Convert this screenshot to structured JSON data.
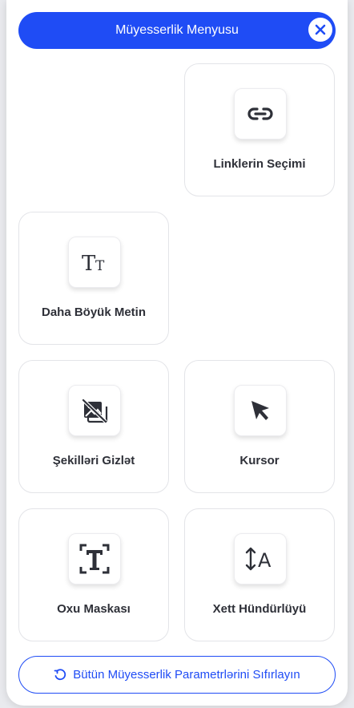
{
  "header": {
    "title": "Müyesserlik Menyusu",
    "close_icon": "close-icon"
  },
  "tiles": {
    "links": {
      "label": "Linklerin Seçimi",
      "icon": "link-icon"
    },
    "bigger_text": {
      "label": "Daha Böyük Metin",
      "icon": "text-size-icon"
    },
    "hide_images": {
      "label": "Şekilləri Gizlət",
      "icon": "hide-image-icon"
    },
    "cursor": {
      "label": "Kursor",
      "icon": "cursor-icon"
    },
    "reading_mask": {
      "label": "Oxu Maskası",
      "icon": "reading-mask-icon"
    },
    "line_height": {
      "label": "Xett Hündürlüyü",
      "icon": "line-height-icon"
    }
  },
  "footer": {
    "reset_label": "Bütün Müyesserlik Parametrlərini Sıfırlayın",
    "icon": "reset-icon"
  },
  "colors": {
    "accent": "#1f4cf5",
    "text": "#2e3038",
    "border": "#e3e4e8"
  }
}
